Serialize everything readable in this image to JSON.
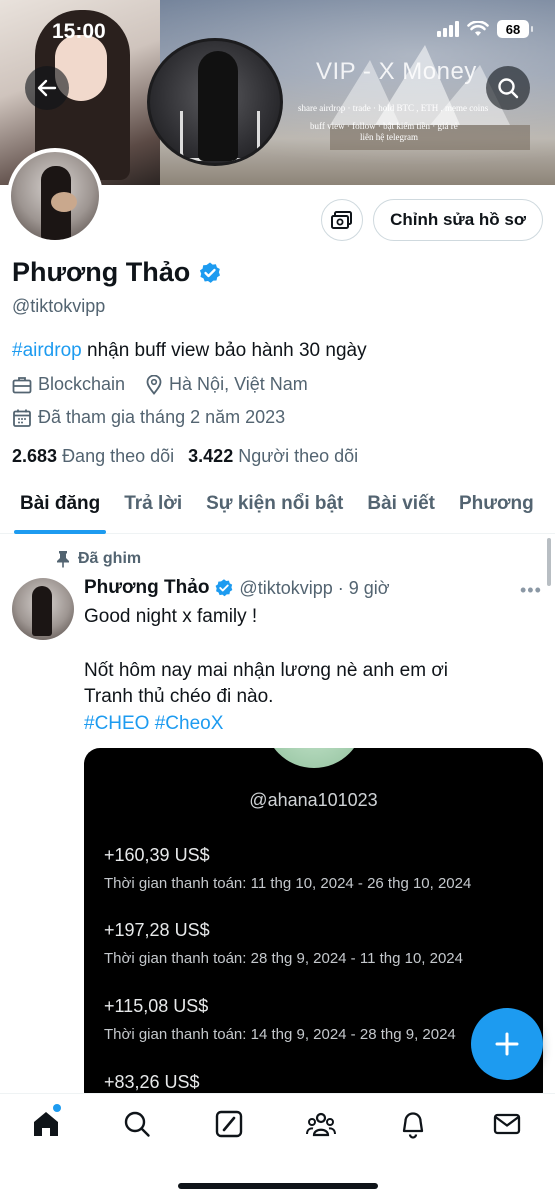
{
  "status_bar": {
    "time": "15:00",
    "battery": "68"
  },
  "banner": {
    "title": "VIP - X Money",
    "line1": "share airdrop · trade · hold  BTC , ETH , meme coins",
    "line2": "buff view · follow · bật kiếm tiền · giá rẻ",
    "line3": "liên hệ telegram"
  },
  "profile": {
    "edit_label": "Chỉnh sửa hồ sơ",
    "name": "Phương Thảo",
    "handle": "@tiktokvipp",
    "bio_hashtag": "#airdrop",
    "bio_text": " nhận buff view bảo hành 30 ngày",
    "category": "Blockchain",
    "location": "Hà Nội, Việt Nam",
    "joined": "Đã tham gia tháng 2 năm 2023",
    "following_count": "2.683",
    "following_label": "Đang theo dõi",
    "followers_count": "3.422",
    "followers_label": "Người theo dõi"
  },
  "tabs": [
    "Bài đăng",
    "Trả lời",
    "Sự kiện nổi bật",
    "Bài viết",
    "Phương"
  ],
  "post": {
    "pinned_label": "Đã ghim",
    "name": "Phương Thảo",
    "handle": "@tiktokvipp",
    "time": "· 9 giờ",
    "line1": "Good night x family !",
    "line2": "Nốt hôm nay mai nhận lương nè anh em ơi",
    "line3": "Tranh thủ chéo đi nào.",
    "hashtags": "#CHEO #CheoX",
    "media": {
      "handle": "@ahana101023",
      "payments": [
        {
          "amount": "+160,39 US$",
          "period": "Thời gian thanh toán: 11 thg 10, 2024 - 26 thg 10, 2024"
        },
        {
          "amount": "+197,28 US$",
          "period": "Thời gian thanh toán: 28 thg 9, 2024 - 11 thg 10, 2024"
        },
        {
          "amount": "+115,08 US$",
          "period": "Thời gian thanh toán: 14 thg 9, 2024 - 28 thg 9, 2024"
        },
        {
          "amount": "+83,26 US$",
          "period": ""
        }
      ]
    }
  },
  "nav": [
    "home-icon",
    "search-icon",
    "grok-icon",
    "communities-icon",
    "notifications-icon",
    "messages-icon"
  ],
  "colors": {
    "accent": "#1d9bf0",
    "text": "#0f1419",
    "muted": "#536471"
  }
}
